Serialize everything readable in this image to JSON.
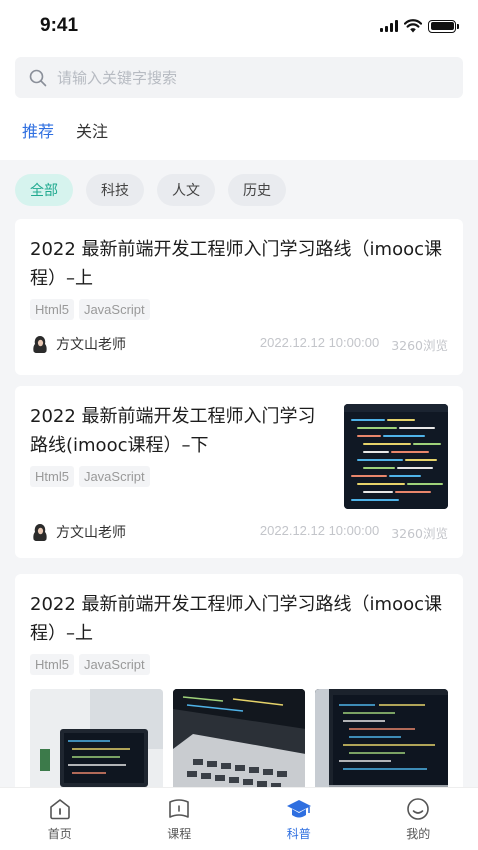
{
  "status_bar": {
    "time": "9:41"
  },
  "search": {
    "placeholder": "请输入关键字搜索",
    "value": ""
  },
  "tabs": [
    {
      "label": "推荐",
      "active": true
    },
    {
      "label": "关注",
      "active": false
    }
  ],
  "categories": [
    {
      "label": "全部",
      "active": true
    },
    {
      "label": "科技",
      "active": false
    },
    {
      "label": "人文",
      "active": false
    },
    {
      "label": "历史",
      "active": false
    }
  ],
  "articles": [
    {
      "title": "2022 最新前端开发工程师入门学习路线（imooc课程）–上",
      "tags": [
        "Html5",
        "JavaScript"
      ],
      "author": "方文山老师",
      "date": "2022.12.12 10:00:00",
      "views": "3260浏览"
    },
    {
      "title": "2022 最新前端开发工程师入门学习路线(imooc课程）–下",
      "tags": [
        "Html5",
        "JavaScript"
      ],
      "author": "方文山老师",
      "date": "2022.12.12 10:00:00",
      "views": "3260浏览",
      "thumbnail": "code-screen-image"
    },
    {
      "title": "2022 最新前端开发工程师入门学习路线（imooc课程）–上",
      "tags": [
        "Html5",
        "JavaScript"
      ],
      "images": [
        "laptop-desk-image",
        "laptop-code-image",
        "code-screen-image"
      ]
    }
  ],
  "tabbar": [
    {
      "label": "首页",
      "icon": "home-icon",
      "active": false
    },
    {
      "label": "课程",
      "icon": "book-icon",
      "active": false
    },
    {
      "label": "科普",
      "icon": "graduation-cap-icon",
      "active": true
    },
    {
      "label": "我的",
      "icon": "profile-icon",
      "active": false
    }
  ],
  "colors": {
    "accent": "#2f6fe0",
    "chip_active_bg": "#d6f3ee",
    "chip_active_text": "#1fa98f"
  }
}
